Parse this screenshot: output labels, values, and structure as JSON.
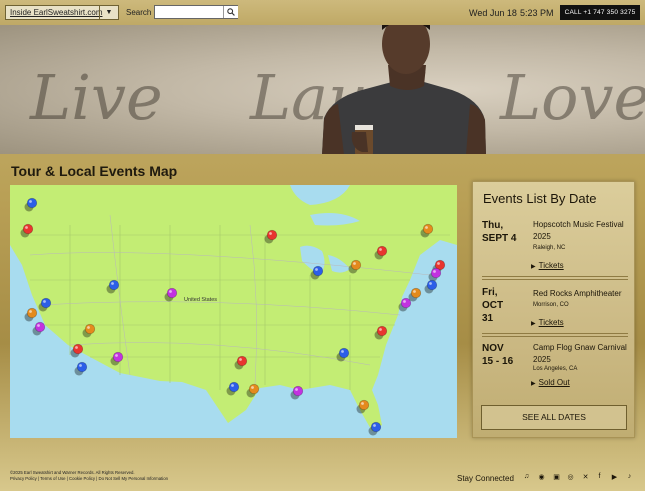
{
  "header": {
    "site_select": "Inside EarlSweatshirt.com",
    "search_label": "Search",
    "search_placeholder": "",
    "date": "Wed Jun 18",
    "time": "5:23 PM",
    "call_button": "CALL +1 747 350 3275"
  },
  "banner": {
    "script_words": [
      "Live",
      "Laugh",
      "Love"
    ]
  },
  "map_section": {
    "title": "Tour & Local Events Map",
    "country_label": "United States"
  },
  "events": {
    "title": "Events List By Date",
    "items": [
      {
        "date_line1": "Thu,",
        "date_line2": "SEPT 4",
        "date_line3": "",
        "name": "Hopscotch Music Festival 2025",
        "location": "Raleigh, NC",
        "link": "Tickets"
      },
      {
        "date_line1": "Fri,",
        "date_line2": "OCT",
        "date_line3": "31",
        "name": "Red Rocks Amphitheater",
        "location": "Morrison, CO",
        "link": "Tickets"
      },
      {
        "date_line1": "NOV",
        "date_line2": "15 - 16",
        "date_line3": "",
        "name": "Camp Flog Gnaw Carnival 2025",
        "location": "Los Angeles, CA",
        "link": "Sold Out"
      }
    ],
    "see_all": "SEE ALL DATES"
  },
  "footer": {
    "copyright": "©2025 Earl Sweatshirt and Warner Records. All Rights Reserved.",
    "links": "Privacy Policy | Terms of Use | Cookie Policy | Do Not Sell My Personal Information",
    "stay_connected": "Stay Connected",
    "social_icons": [
      "apple-music-icon",
      "spotify-icon",
      "amazon-music-icon",
      "instagram-icon",
      "x-icon",
      "facebook-icon",
      "youtube-icon",
      "tiktok-icon"
    ]
  },
  "colors": {
    "pin_red": "#e8352f",
    "pin_purple": "#c232e0",
    "pin_blue": "#2c5ee8",
    "pin_orange": "#e48a1d",
    "land": "#c3ed74",
    "water": "#a8dcef"
  }
}
